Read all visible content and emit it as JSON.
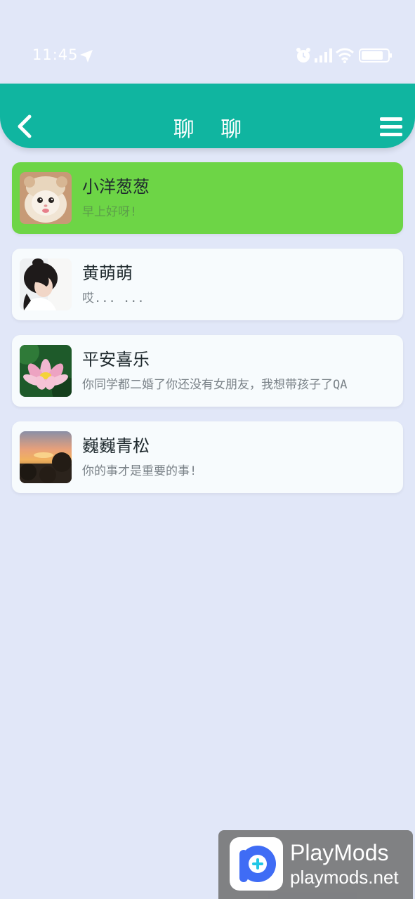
{
  "status_bar": {
    "time": "11:45",
    "icons": [
      "location-arrow-icon",
      "alarm-icon",
      "signal-icon",
      "wifi-icon",
      "battery-icon"
    ]
  },
  "header": {
    "title": "聊 聊",
    "back_icon": "chevron-left-icon",
    "menu_icon": "hamburger-menu-icon",
    "color": "#10b5a0"
  },
  "chats": [
    {
      "name": "小洋葱葱",
      "preview": "早上好呀!",
      "avatar": "kitten-avatar",
      "active": true
    },
    {
      "name": "黄萌萌",
      "preview": "哎... ...",
      "avatar": "girl-avatar",
      "active": false
    },
    {
      "name": "平安喜乐",
      "preview": "你同学都二婚了你还没有女朋友，我想带孩子了QA",
      "avatar": "lotus-avatar",
      "active": false
    },
    {
      "name": "巍巍青松",
      "preview": "你的事才是重要的事!",
      "avatar": "sunset-avatar",
      "active": false
    }
  ],
  "colors": {
    "background": "#e1e7f8",
    "active_card": "#6dd546",
    "card": "#f7fbfd"
  },
  "watermark": {
    "title": "PlayMods",
    "url": "playmods.net"
  }
}
